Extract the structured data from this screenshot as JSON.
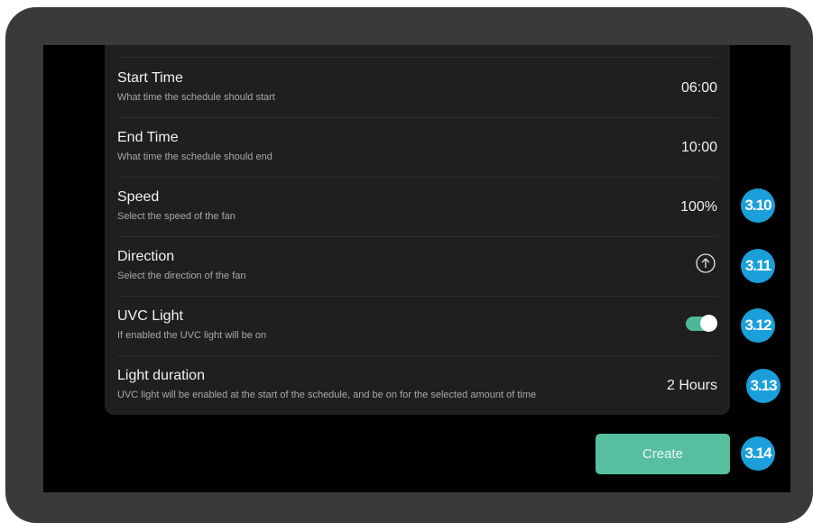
{
  "settings": {
    "rows": [
      {
        "title": "Start Time",
        "desc": "What time the schedule should start",
        "value": "06:00"
      },
      {
        "title": "End Time",
        "desc": "What time the schedule should end",
        "value": "10:00"
      },
      {
        "title": "Speed",
        "desc": "Select the speed of the fan",
        "value": "100%"
      },
      {
        "title": "Direction",
        "desc": "Select the direction of the fan",
        "icon": "arrow-up-circle-icon"
      },
      {
        "title": "UVC Light",
        "desc": "If enabled the UVC light will be on",
        "toggle_on": true
      },
      {
        "title": "Light duration",
        "desc": "UVC light will be enabled at the start of the schedule, and be on for the selected amount of time",
        "value": "2 Hours"
      }
    ]
  },
  "actions": {
    "create_label": "Create"
  },
  "callouts": [
    "3.10",
    "3.11",
    "3.12",
    "3.13",
    "3.14"
  ],
  "colors": {
    "accent": "#56bfa0",
    "badge": "#1a9fda",
    "panel": "#1f1f1f",
    "screen": "#000000",
    "bezel": "#3a3a3a"
  }
}
